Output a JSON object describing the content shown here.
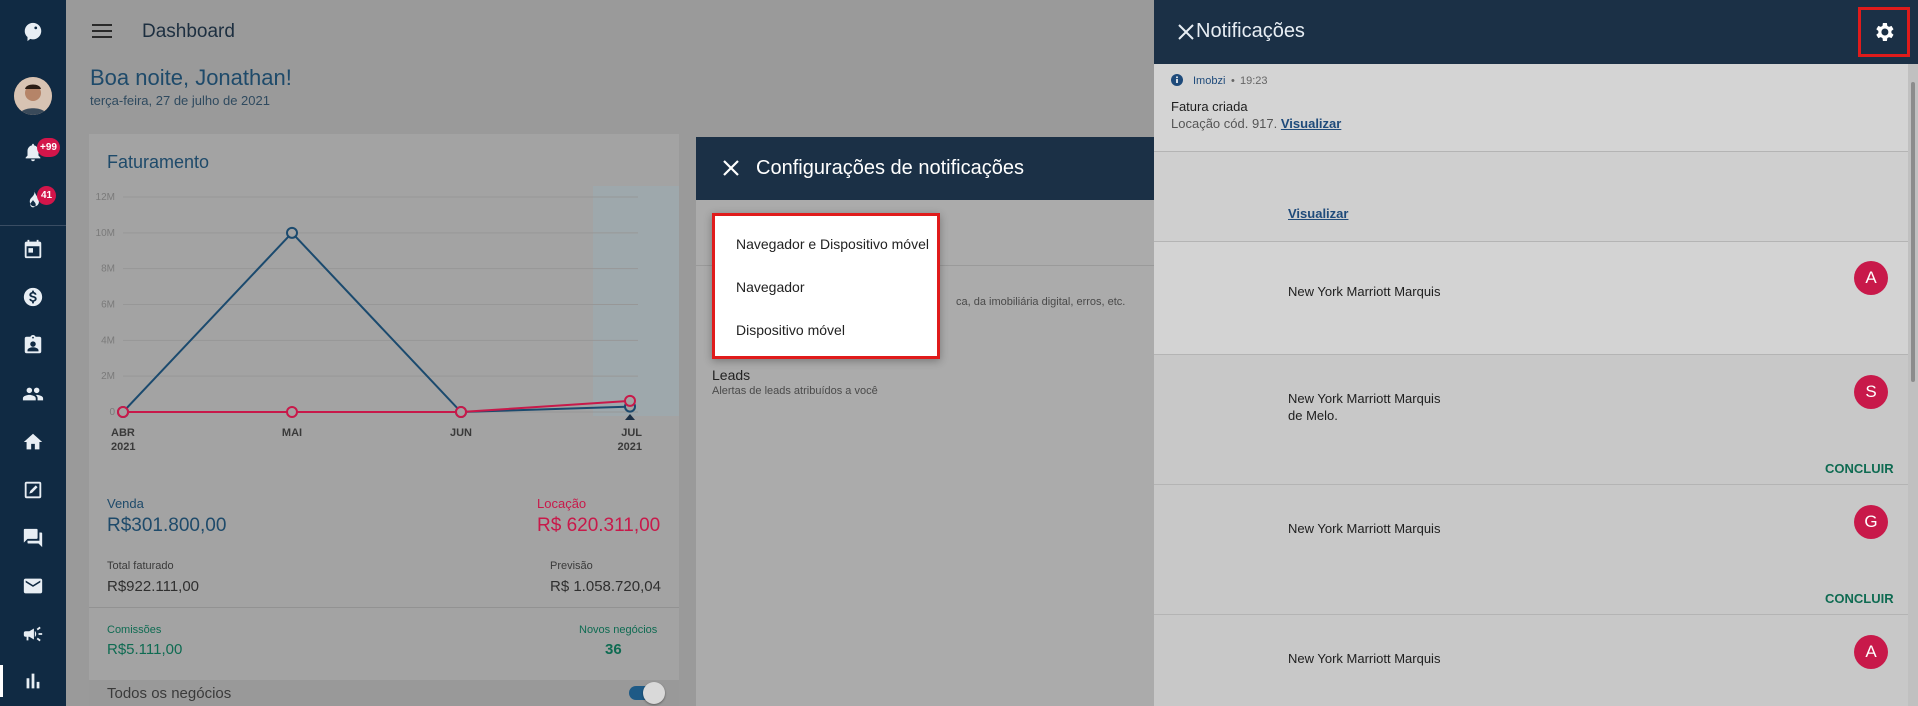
{
  "sidebar": {
    "badges": {
      "notifications": "+99",
      "tasks": "41"
    },
    "icons": [
      "logo-icon",
      "avatar",
      "bell-icon",
      "flame-icon",
      "calendar-icon",
      "dollar-icon",
      "clipboard-icon",
      "people-icon",
      "home-icon",
      "edit-icon",
      "chat-icon",
      "mail-icon",
      "megaphone-icon",
      "bar-chart-icon"
    ]
  },
  "header": {
    "title": "Dashboard"
  },
  "welcome": {
    "greeting": "Boa noite, Jonathan!",
    "date": "terça-feira, 27 de julho de 2021"
  },
  "billing": {
    "title": "Faturamento",
    "sale_label": "Venda",
    "sale_value": "R$301.800,00",
    "rent_label": "Locação",
    "rent_value": "R$ 620.311,00",
    "total_label": "Total faturado",
    "total_value": "R$922.111,00",
    "forecast_label": "Previsão",
    "forecast_value": "R$ 1.058.720,04",
    "commission_label": "Comissões",
    "commission_value": "R$5.111,00",
    "new_deals_label": "Novos negócios",
    "new_deals_value": "36",
    "all_deals_label": "Todos os negócios"
  },
  "chart_data": {
    "type": "line",
    "categories": [
      "ABR 2021",
      "MAI",
      "JUN",
      "JUL 2021"
    ],
    "tick_labels": [
      "12M",
      "10M",
      "8M",
      "6M",
      "4M",
      "2M",
      "0"
    ],
    "ylim": [
      0,
      12000000
    ],
    "series": [
      {
        "values": [
          0,
          10000000,
          0,
          301800
        ],
        "color": "#1b4a6e"
      },
      {
        "values": [
          0,
          0,
          0,
          620311
        ],
        "color": "#c8194a"
      }
    ],
    "grid": true
  },
  "dialog": {
    "title": "Configurações de notificações",
    "rows": [
      {
        "sub": "ca, da imobiliária digital, erros, etc.",
        "on": false
      },
      {
        "on": true
      },
      {
        "label": "Leads",
        "sub": "Alertas de leads atribuídos a você",
        "on": true
      }
    ]
  },
  "dropdown": {
    "options": [
      "Navegador e Dispositivo móvel",
      "Navegador",
      "Dispositivo móvel"
    ]
  },
  "notifications": {
    "title": "Notificações",
    "first": {
      "source": "Imobzi",
      "time": "19:23",
      "title": "Fatura criada",
      "body": "Locação cód. 917.",
      "link": "Visualizar"
    },
    "second": {
      "link": "Visualizar"
    },
    "items": [
      {
        "hotel": "New York Marriott Marquis",
        "avatar": "A",
        "extra": "",
        "concluir": ""
      },
      {
        "hotel": "New York Marriott Marquis",
        "avatar": "S",
        "extra": "de Melo.",
        "concluir": "CONCLUIR"
      },
      {
        "hotel": "New York Marriott Marquis",
        "avatar": "G",
        "extra": "",
        "concluir": "CONCLUIR"
      },
      {
        "hotel": "New York Marriott Marquis",
        "avatar": "A",
        "extra": "",
        "concluir": ""
      }
    ]
  }
}
